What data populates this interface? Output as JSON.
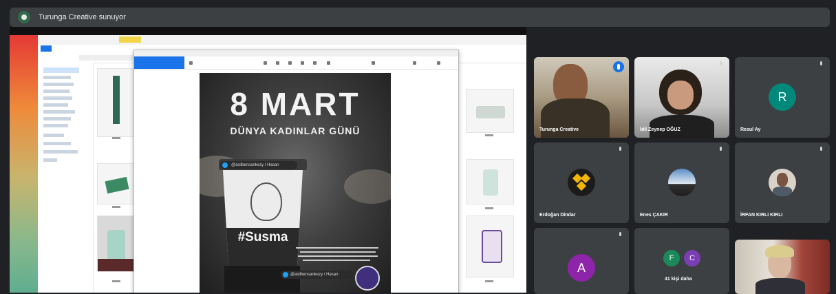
{
  "presenting_banner": {
    "text": "Turunga Creative sunuyor"
  },
  "shared_screen": {
    "poster": {
      "title": "8 MART",
      "subtitle": "DÜNYA KADINLAR GÜNÜ",
      "hashtag": "#Susma",
      "twitter_handle": "@asilbensankezy / Hasan"
    }
  },
  "participants": [
    {
      "name": "Turunga Creative",
      "speaking": true
    },
    {
      "name": "İdil Zeynep OĞUZ",
      "speaking": false
    },
    {
      "name": "Resul Ay",
      "avatar_letter": "R",
      "avatar_color": "#00897b"
    },
    {
      "name": "Erdoğan Dindar"
    },
    {
      "name": "Enes ÇAKIR"
    },
    {
      "name": "İRFAN KIRLI KIRLI"
    },
    {
      "name": "",
      "avatar_letter": "A",
      "avatar_color": "#8e24aa"
    },
    {
      "name": "41 kişi daha",
      "avatar_letters": [
        "F",
        "C"
      ],
      "avatar_colors": [
        "#1b8a5a",
        "#7b3fb5"
      ]
    },
    {
      "name": ""
    }
  ],
  "colors": {
    "meet_bg": "#202124",
    "tile_bg": "#3c4043",
    "accent": "#1a73e8"
  }
}
